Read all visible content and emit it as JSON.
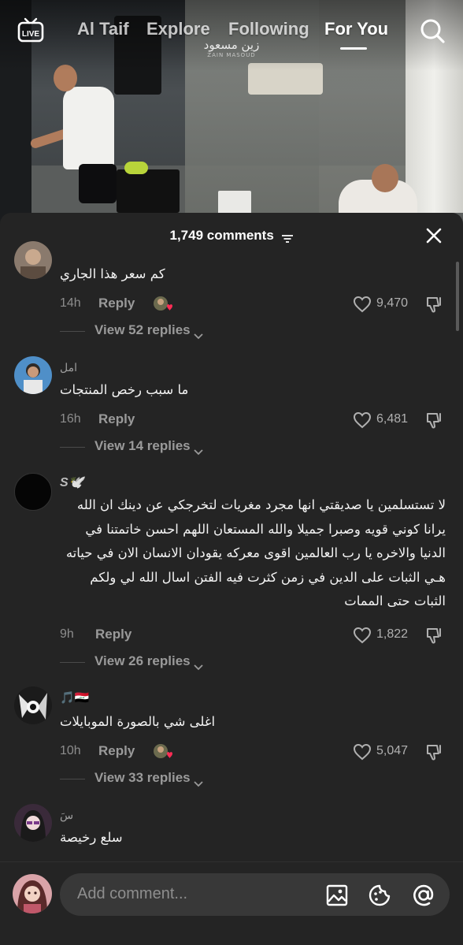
{
  "top_nav": {
    "live_label": "LIVE",
    "tabs": [
      {
        "label": "Al Taif"
      },
      {
        "label": "Explore"
      },
      {
        "label": "Following"
      },
      {
        "label": "For You"
      }
    ]
  },
  "video": {
    "watermark": "زين مسعود",
    "watermark_sub": "ZAIN MASOUD"
  },
  "sheet": {
    "comment_count": "1,749 comments"
  },
  "comments": [
    {
      "username": "",
      "text": "كم سعر هذا الجاري",
      "time": "14h",
      "reply_label": "Reply",
      "likes": "9,470",
      "creator_liked": true,
      "view_replies": "View 52 replies"
    },
    {
      "username": "امل",
      "text": "ما سبب رخص المنتجات",
      "time": "16h",
      "reply_label": "Reply",
      "likes": "6,481",
      "creator_liked": false,
      "view_replies": "View 14 replies"
    },
    {
      "username": "S🕊️",
      "text": "لا تستسلمين يا صديقتي انها مجرد مغريات لتخرجكي عن دينك ان الله يرانا كوني قويه وصبرا جميلا والله المستعان اللهم احسن خاتمتنا في الدنيا والاخره يا رب العالمين اقوى معركه يقودان الانسان الان في حياته هـي الثبات على الدين في زمن كثرت فيه الفتن اسال الله لي ولكم الثبات حتى الممات",
      "time": "9h",
      "reply_label": "Reply",
      "likes": "1,822",
      "creator_liked": false,
      "view_replies": "View 26 replies"
    },
    {
      "username": "🎵🇮🇶",
      "text": "اغلى شي بالصورة الموبايلات",
      "time": "10h",
      "reply_label": "Reply",
      "likes": "5,047",
      "creator_liked": true,
      "view_replies": "View 33 replies"
    },
    {
      "username": "سَ",
      "text": "سلع رخيصة",
      "time": "",
      "reply_label": "",
      "likes": "",
      "creator_liked": false,
      "view_replies": ""
    }
  ],
  "input": {
    "placeholder": "Add comment..."
  },
  "icons": {
    "live": "live-tv-icon",
    "search": "search-icon",
    "filter": "filter-icon",
    "close": "close-icon",
    "heart": "heart-icon",
    "dislike": "dislike-icon",
    "image": "image-icon",
    "emoji": "emoji-icon",
    "mention": "at-mention-icon"
  },
  "colors": {
    "sheet_bg": "#242424",
    "creator_heart": "#fe2c55",
    "muted_text": "#9a9a9a"
  }
}
